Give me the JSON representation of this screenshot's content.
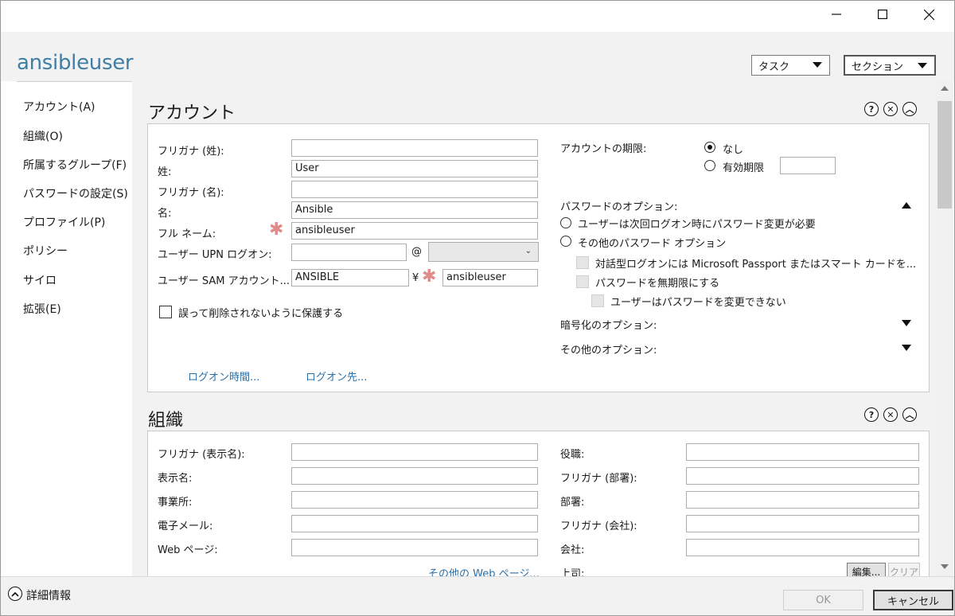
{
  "window": {
    "title": "ansibleuser",
    "controls": [
      "minimize-icon",
      "maximize-icon",
      "close-icon"
    ]
  },
  "header": {
    "tasks_label": "タスク",
    "sections_label": "セクション"
  },
  "sidebar": {
    "items": [
      {
        "label": "アカウント(A)"
      },
      {
        "label": "組織(O)"
      },
      {
        "label": "所属するグループ(F)"
      },
      {
        "label": "パスワードの設定(S)"
      },
      {
        "label": "プロファイル(P)"
      },
      {
        "label": "ポリシー"
      },
      {
        "label": "サイロ"
      },
      {
        "label": "拡張(E)"
      }
    ]
  },
  "account": {
    "title": "アカウント",
    "icons": [
      "help-icon",
      "close-icon",
      "collapse-icon"
    ],
    "fields": {
      "furigana_last": {
        "label": "フリガナ (姓):",
        "value": ""
      },
      "last_name": {
        "label": "姓:",
        "value": "User"
      },
      "furigana_first": {
        "label": "フリガナ (名):",
        "value": ""
      },
      "first_name": {
        "label": "名:",
        "value": "Ansible"
      },
      "full_name": {
        "label": "フル ネーム:",
        "value": "ansibleuser"
      },
      "upn": {
        "label": "ユーザー UPN ログオン:",
        "value": "",
        "at": "@",
        "domain": ""
      },
      "sam": {
        "label": "ユーザー SAM アカウント...",
        "domain": "ANSIBLE",
        "yen": "¥",
        "value": "ansibleuser"
      }
    },
    "protect_label": "誤って削除されないように保護する",
    "logon_hours_link": "ログオン時間...",
    "logon_to_link": "ログオン先...",
    "expiry": {
      "label": "アカウントの期限:",
      "never": "なし",
      "end_of": "有効期限",
      "selected": "never"
    },
    "password_options": {
      "label": "パスワードのオプション:",
      "must_change": "ユーザーは次回ログオン時にパスワード変更が必要",
      "other": "その他のパスワード オプション",
      "smart_card": "対話型ログオンには Microsoft Passport またはスマート カードを...",
      "never_expires": "パスワードを無期限にする",
      "cannot_change": "ユーザーはパスワードを変更できない"
    },
    "encryption_options": "暗号化のオプション:",
    "other_options": "その他のオプション:"
  },
  "organization": {
    "title": "組織",
    "icons": [
      "help-icon",
      "close-icon",
      "collapse-icon"
    ],
    "left_fields": [
      {
        "label": "フリガナ (表示名):",
        "value": ""
      },
      {
        "label": "表示名:",
        "value": ""
      },
      {
        "label": "事業所:",
        "value": ""
      },
      {
        "label": "電子メール:",
        "value": ""
      },
      {
        "label": "Web ページ:",
        "value": ""
      }
    ],
    "other_web_link": "その他の Web ページ...",
    "right_fields": [
      {
        "label": "役職:",
        "value": ""
      },
      {
        "label": "フリガナ (部署):",
        "value": ""
      },
      {
        "label": "部署:",
        "value": ""
      },
      {
        "label": "フリガナ (会社):",
        "value": ""
      },
      {
        "label": "会社:",
        "value": ""
      }
    ],
    "manager_label": "上司:",
    "edit_label": "編集...",
    "clear_label": "クリア"
  },
  "footer": {
    "details_label": "詳細情報",
    "ok_label": "OK",
    "cancel_label": "キャンセル"
  }
}
